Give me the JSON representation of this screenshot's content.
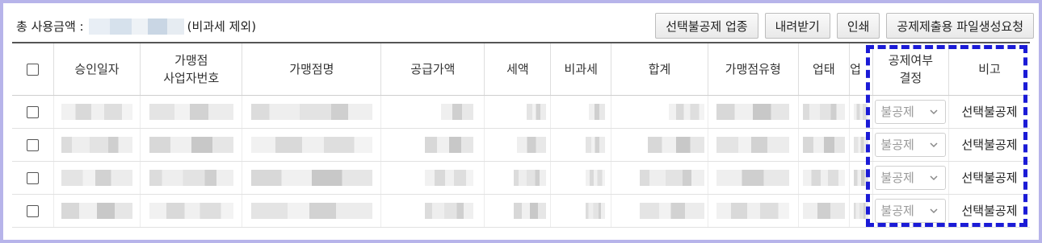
{
  "summary": {
    "total_label": "총 사용금액 :",
    "total_note": "(비과세 제외)"
  },
  "toolbar": {
    "buttons": [
      "선택불공제 업종",
      "내려받기",
      "인쇄",
      "공제제출용 파일생성요청"
    ]
  },
  "table": {
    "headers": [
      "승인일자",
      "가맹점\n사업자번호",
      "가맹점명",
      "공급가액",
      "세액",
      "비과세",
      "합계",
      "가맹점유형",
      "업태",
      "업",
      "공제여부\n결정",
      "비고"
    ],
    "rows": [
      {
        "deduction": "불공제",
        "note": "선택불공제"
      },
      {
        "deduction": "불공제",
        "note": "선택불공제"
      },
      {
        "deduction": "불공제",
        "note": "선택불공제"
      },
      {
        "deduction": "불공제",
        "note": "선택불공제"
      }
    ]
  },
  "colors": {
    "frame_border": "#b7b4ea",
    "highlight_dash": "#1b1bd6"
  }
}
